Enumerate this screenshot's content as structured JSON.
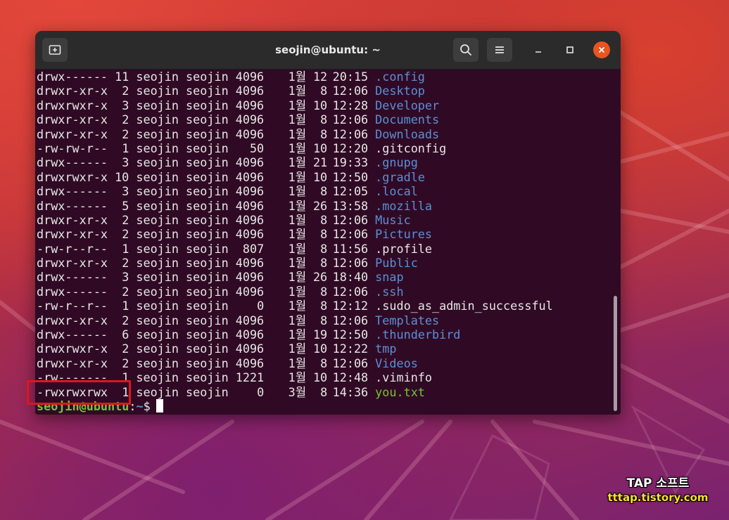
{
  "window": {
    "title": "seojin@ubuntu: ~"
  },
  "titlebar": {
    "icons": {
      "new_tab": "new-tab-icon",
      "search": "search-icon",
      "menu": "hamburger-menu-icon",
      "minimize": "minimize-icon",
      "maximize": "maximize-icon",
      "close": "close-icon"
    }
  },
  "colors": {
    "terminal_bg": "#300a24",
    "directory": "#5b8fd6",
    "executable": "#73c437",
    "plain_file": "#e6e6e6",
    "close_button": "#e95420",
    "highlight_box": "#e0151b"
  },
  "terminal": {
    "listing": [
      {
        "perms": "drwx------",
        "links": "11",
        "owner": "seojin",
        "group": "seojin",
        "size": "4096",
        "month": "1월",
        "day": "12",
        "time": "20:15",
        "name": ".config",
        "kind": "dir"
      },
      {
        "perms": "drwxr-xr-x",
        "links": "2",
        "owner": "seojin",
        "group": "seojin",
        "size": "4096",
        "month": "1월",
        "day": "8",
        "time": "12:06",
        "name": "Desktop",
        "kind": "dir"
      },
      {
        "perms": "drwxrwxr-x",
        "links": "3",
        "owner": "seojin",
        "group": "seojin",
        "size": "4096",
        "month": "1월",
        "day": "10",
        "time": "12:28",
        "name": "Developer",
        "kind": "dir"
      },
      {
        "perms": "drwxr-xr-x",
        "links": "2",
        "owner": "seojin",
        "group": "seojin",
        "size": "4096",
        "month": "1월",
        "day": "8",
        "time": "12:06",
        "name": "Documents",
        "kind": "dir"
      },
      {
        "perms": "drwxr-xr-x",
        "links": "2",
        "owner": "seojin",
        "group": "seojin",
        "size": "4096",
        "month": "1월",
        "day": "8",
        "time": "12:06",
        "name": "Downloads",
        "kind": "dir"
      },
      {
        "perms": "-rw-rw-r--",
        "links": "1",
        "owner": "seojin",
        "group": "seojin",
        "size": "50",
        "month": "1월",
        "day": "10",
        "time": "12:20",
        "name": ".gitconfig",
        "kind": "file"
      },
      {
        "perms": "drwx------",
        "links": "3",
        "owner": "seojin",
        "group": "seojin",
        "size": "4096",
        "month": "1월",
        "day": "21",
        "time": "19:33",
        "name": ".gnupg",
        "kind": "dir"
      },
      {
        "perms": "drwxrwxr-x",
        "links": "10",
        "owner": "seojin",
        "group": "seojin",
        "size": "4096",
        "month": "1월",
        "day": "10",
        "time": "12:50",
        "name": ".gradle",
        "kind": "dir"
      },
      {
        "perms": "drwx------",
        "links": "3",
        "owner": "seojin",
        "group": "seojin",
        "size": "4096",
        "month": "1월",
        "day": "8",
        "time": "12:05",
        "name": ".local",
        "kind": "dir"
      },
      {
        "perms": "drwx------",
        "links": "5",
        "owner": "seojin",
        "group": "seojin",
        "size": "4096",
        "month": "1월",
        "day": "26",
        "time": "13:58",
        "name": ".mozilla",
        "kind": "dir"
      },
      {
        "perms": "drwxr-xr-x",
        "links": "2",
        "owner": "seojin",
        "group": "seojin",
        "size": "4096",
        "month": "1월",
        "day": "8",
        "time": "12:06",
        "name": "Music",
        "kind": "dir"
      },
      {
        "perms": "drwxr-xr-x",
        "links": "2",
        "owner": "seojin",
        "group": "seojin",
        "size": "4096",
        "month": "1월",
        "day": "8",
        "time": "12:06",
        "name": "Pictures",
        "kind": "dir"
      },
      {
        "perms": "-rw-r--r--",
        "links": "1",
        "owner": "seojin",
        "group": "seojin",
        "size": "807",
        "month": "1월",
        "day": "8",
        "time": "11:56",
        "name": ".profile",
        "kind": "file"
      },
      {
        "perms": "drwxr-xr-x",
        "links": "2",
        "owner": "seojin",
        "group": "seojin",
        "size": "4096",
        "month": "1월",
        "day": "8",
        "time": "12:06",
        "name": "Public",
        "kind": "dir"
      },
      {
        "perms": "drwx------",
        "links": "3",
        "owner": "seojin",
        "group": "seojin",
        "size": "4096",
        "month": "1월",
        "day": "26",
        "time": "18:40",
        "name": "snap",
        "kind": "dir"
      },
      {
        "perms": "drwx------",
        "links": "2",
        "owner": "seojin",
        "group": "seojin",
        "size": "4096",
        "month": "1월",
        "day": "8",
        "time": "12:06",
        "name": ".ssh",
        "kind": "dir"
      },
      {
        "perms": "-rw-r--r--",
        "links": "1",
        "owner": "seojin",
        "group": "seojin",
        "size": "0",
        "month": "1월",
        "day": "8",
        "time": "12:12",
        "name": ".sudo_as_admin_successful",
        "kind": "file"
      },
      {
        "perms": "drwxr-xr-x",
        "links": "2",
        "owner": "seojin",
        "group": "seojin",
        "size": "4096",
        "month": "1월",
        "day": "8",
        "time": "12:06",
        "name": "Templates",
        "kind": "dir"
      },
      {
        "perms": "drwx------",
        "links": "6",
        "owner": "seojin",
        "group": "seojin",
        "size": "4096",
        "month": "1월",
        "day": "19",
        "time": "12:50",
        "name": ".thunderbird",
        "kind": "dir"
      },
      {
        "perms": "drwxrwxr-x",
        "links": "2",
        "owner": "seojin",
        "group": "seojin",
        "size": "4096",
        "month": "1월",
        "day": "10",
        "time": "12:22",
        "name": "tmp",
        "kind": "dir"
      },
      {
        "perms": "drwxr-xr-x",
        "links": "2",
        "owner": "seojin",
        "group": "seojin",
        "size": "4096",
        "month": "1월",
        "day": "8",
        "time": "12:06",
        "name": "Videos",
        "kind": "dir"
      },
      {
        "perms": "-rw-------",
        "links": "1",
        "owner": "seojin",
        "group": "seojin",
        "size": "1221",
        "month": "1월",
        "day": "10",
        "time": "12:48",
        "name": ".viminfo",
        "kind": "file"
      },
      {
        "perms": "-rwxrwxrwx",
        "links": "1",
        "owner": "seojin",
        "group": "seojin",
        "size": "0",
        "month": "3월",
        "day": "8",
        "time": "14:36",
        "name": "you.txt",
        "kind": "exec"
      }
    ],
    "prompt": {
      "user_host": "seojin@ubuntu",
      "separator": ":",
      "path": "~",
      "sign": "$"
    }
  },
  "watermark": {
    "title": "TAP 소프트",
    "url": "tttap.tistory.com"
  }
}
